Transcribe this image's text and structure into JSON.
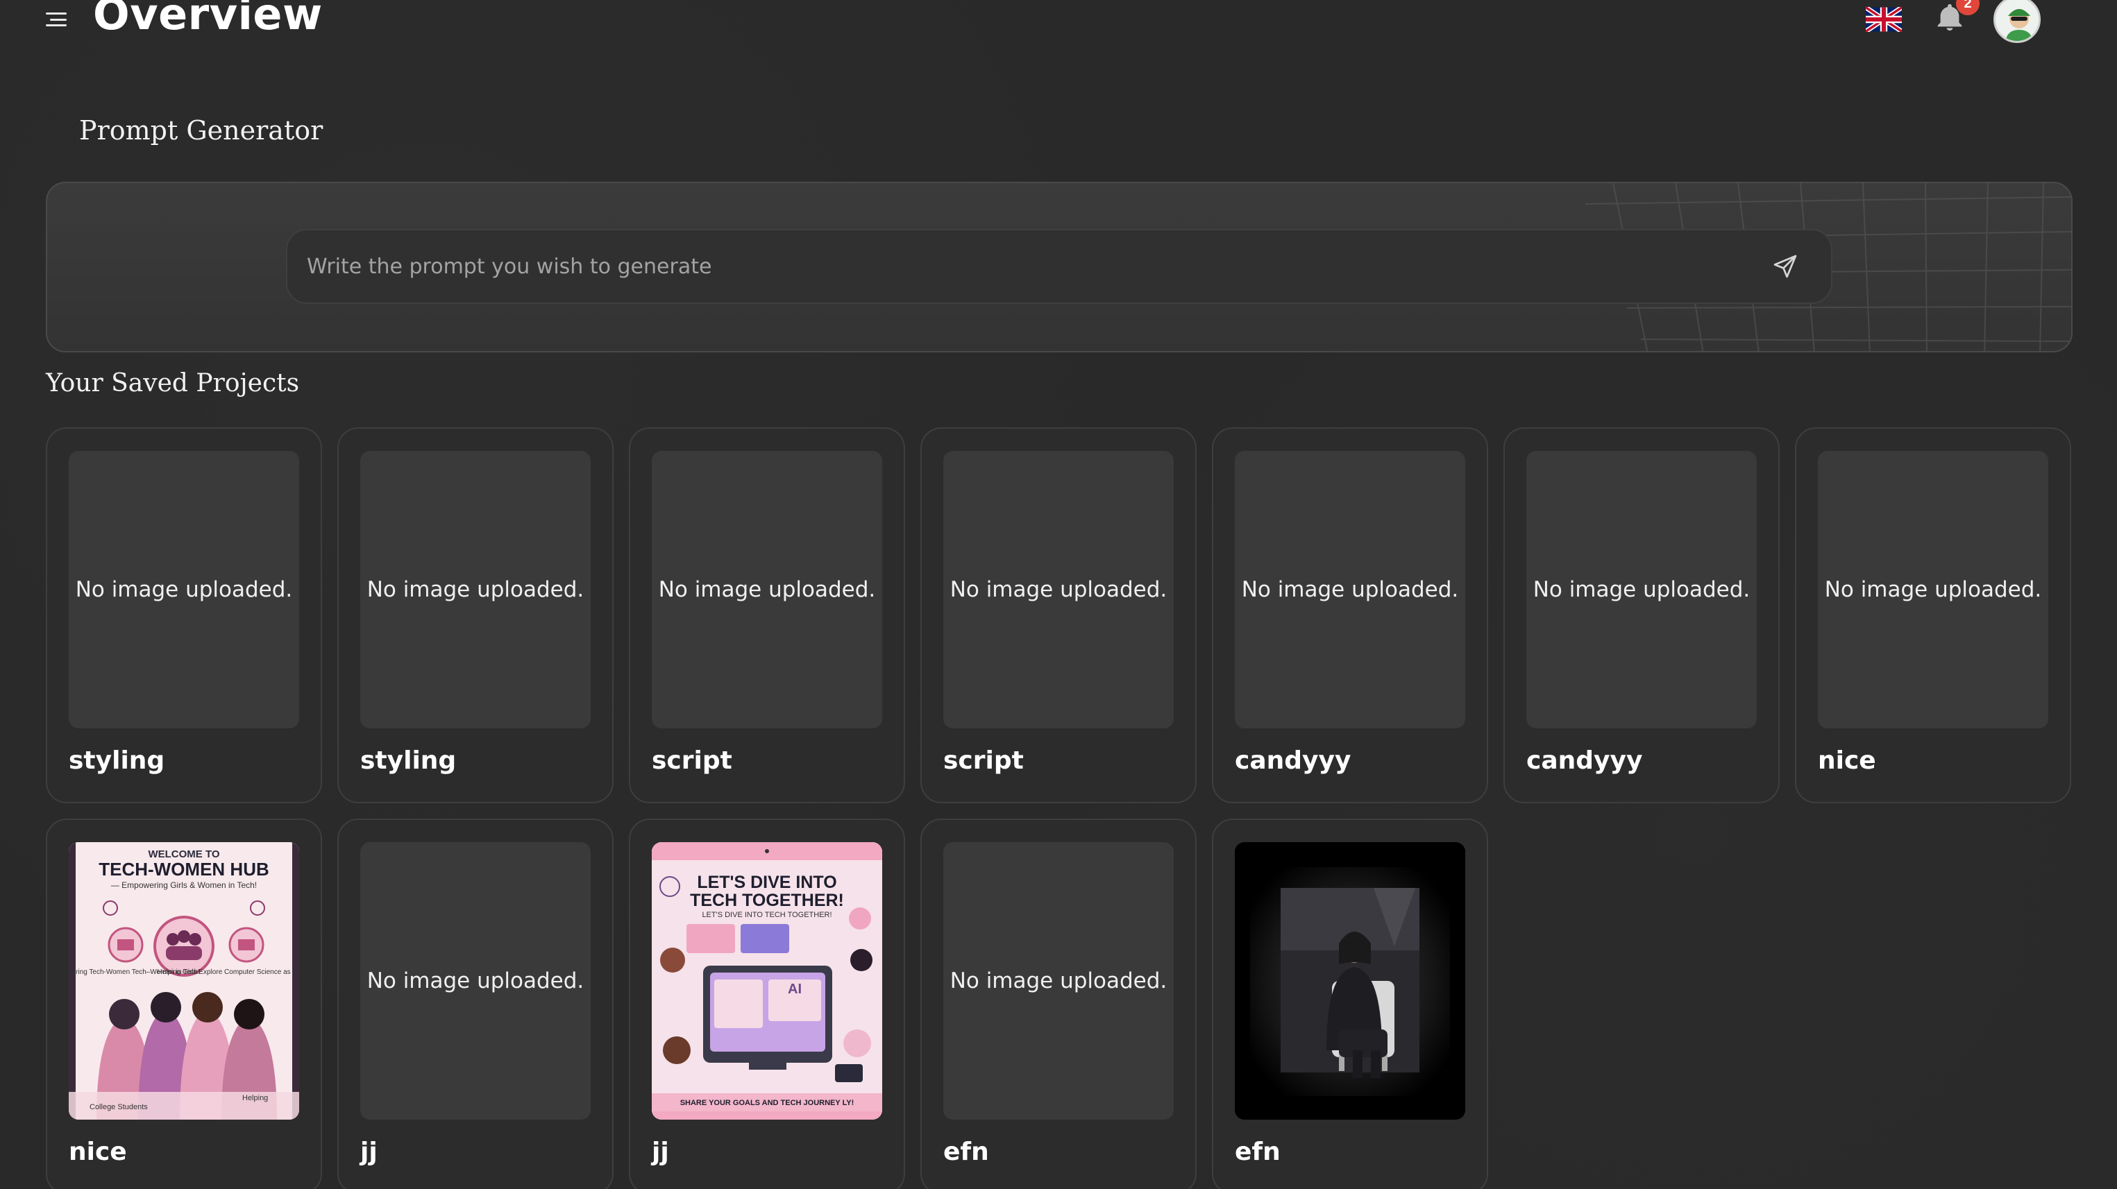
{
  "header": {
    "title": "Overview",
    "notification_count": "2",
    "language_icon": "uk-flag-icon",
    "notification_icon": "bell-icon"
  },
  "prompt_generator": {
    "label": "Prompt Generator",
    "placeholder": "Write the prompt you wish to generate",
    "send_icon": "send-icon"
  },
  "saved_projects": {
    "label": "Your Saved Projects",
    "no_image_text": "No image uploaded.",
    "items": [
      {
        "name": "styling",
        "image": "none"
      },
      {
        "name": "styling",
        "image": "none"
      },
      {
        "name": "script",
        "image": "none"
      },
      {
        "name": "script",
        "image": "none"
      },
      {
        "name": "candyyy",
        "image": "none"
      },
      {
        "name": "candyyy",
        "image": "none"
      },
      {
        "name": "nice",
        "image": "none"
      },
      {
        "name": "nice",
        "image": "tech-women-hub-poster"
      },
      {
        "name": "jj",
        "image": "none"
      },
      {
        "name": "jj",
        "image": "dive-into-tech-poster"
      },
      {
        "name": "efn",
        "image": "none"
      },
      {
        "name": "efn",
        "image": "portrait-photo"
      }
    ],
    "poster_texts": {
      "tech_women": {
        "line1": "WELCOME TO",
        "line2": "TECH-WOMEN HUB",
        "line3": "— Empowering Girls & Women in Tech!",
        "left_note": "Empowering Tech-Women Tech–Women in Tech!",
        "right_note": "Helping Girls Explore Computer Science as a Career Path",
        "bottom_left": "College Students",
        "bottom_right": "Helping"
      },
      "dive_tech": {
        "line1": "LET'S DIVE INTO",
        "line2": "TECH TOGETHER!",
        "sub": "LET'S DIVE INTO TECH TOGETHER!",
        "footer": "SHARE YOUR GOALS AND TECH JOURNEY LY!",
        "screen": "AI"
      }
    }
  },
  "colors": {
    "background": "#292929",
    "card_border": "#3e3e3e",
    "thumb_bg": "#3a3a3a",
    "badge": "#e0473a"
  }
}
